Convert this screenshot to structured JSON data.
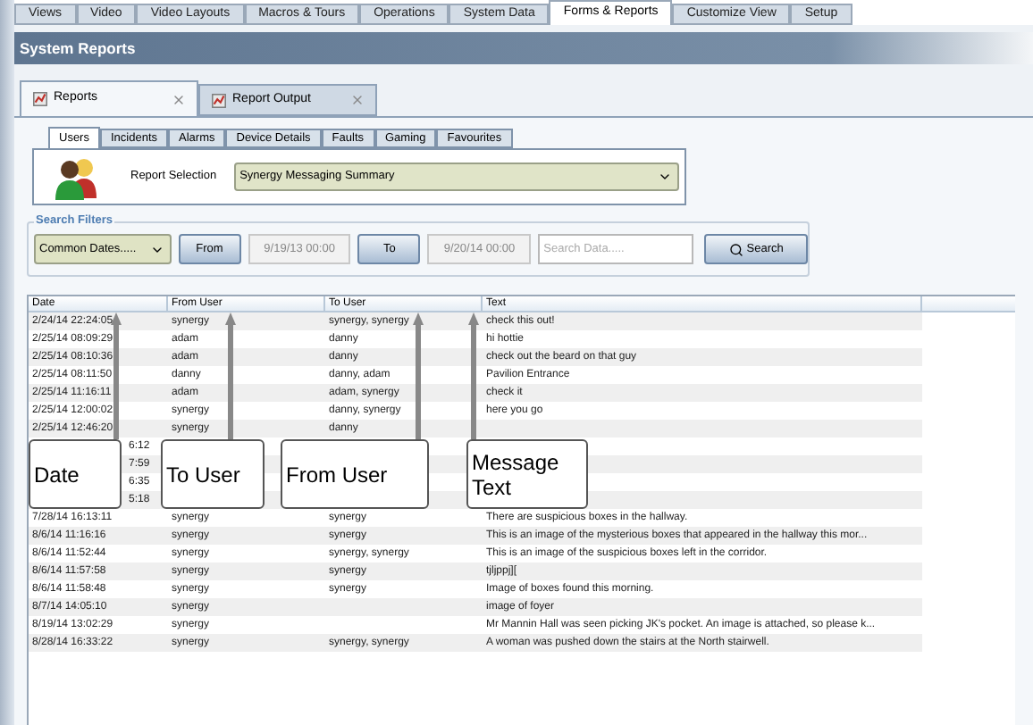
{
  "menu_tabs": [
    {
      "label": "Views",
      "selected": false
    },
    {
      "label": "Video",
      "selected": false
    },
    {
      "label": "Video Layouts",
      "selected": false
    },
    {
      "label": "Macros & Tours",
      "selected": false
    },
    {
      "label": "Operations",
      "selected": false
    },
    {
      "label": "System Data",
      "selected": false
    },
    {
      "label": "Forms & Reports",
      "selected": true
    },
    {
      "label": "Customize View",
      "selected": false
    },
    {
      "label": "Setup",
      "selected": false
    }
  ],
  "panel_title": "System Reports",
  "doc_tabs": [
    {
      "label": "Reports",
      "selected": true
    },
    {
      "label": "Report Output",
      "selected": false
    }
  ],
  "sub_tabs": [
    {
      "label": "Users",
      "selected": true
    },
    {
      "label": "Incidents",
      "selected": false
    },
    {
      "label": "Alarms",
      "selected": false
    },
    {
      "label": "Device Details",
      "selected": false
    },
    {
      "label": "Faults",
      "selected": false
    },
    {
      "label": "Gaming",
      "selected": false
    },
    {
      "label": "Favourites",
      "selected": false
    }
  ],
  "report_selection": {
    "label": "Report Selection",
    "value": "Synergy Messaging Summary"
  },
  "search_filters": {
    "title": "Search Filters",
    "preset": "Common Dates.....",
    "from_button": "From",
    "from_value": "9/19/13 00:00",
    "to_button": "To",
    "to_value": "9/20/14 00:00",
    "search_placeholder": "Search Data.....",
    "search_button": "Search"
  },
  "table": {
    "columns": [
      "Date",
      "From User",
      "To User",
      "Text"
    ],
    "rows": [
      {
        "cells": [
          "2/24/14 22:24:05",
          "synergy",
          "synergy, synergy",
          "check this out!"
        ]
      },
      {
        "cells": [
          "2/25/14 08:09:29",
          "adam",
          "danny",
          "hi hottie"
        ]
      },
      {
        "cells": [
          "2/25/14 08:10:36",
          "adam",
          "danny",
          "check out the beard on that guy"
        ]
      },
      {
        "cells": [
          "2/25/14 08:11:50",
          "danny",
          "danny, adam",
          "Pavilion Entrance"
        ]
      },
      {
        "cells": [
          "2/25/14 11:16:11",
          "adam",
          "adam, synergy",
          "check it"
        ]
      },
      {
        "cells": [
          "2/25/14 12:00:02",
          "synergy",
          "danny, synergy",
          "here you go"
        ]
      },
      {
        "cells": [
          "2/25/14 12:46:20",
          "synergy",
          "danny"
        ]
      },
      {
        "cells": [
          "6:12"
        ]
      },
      {
        "cells": [
          "7:59"
        ]
      },
      {
        "cells": [
          "6:35"
        ]
      },
      {
        "cells": [
          "5:18"
        ]
      },
      {
        "cells": [
          "7/28/14 16:13:11",
          "synergy",
          "synergy",
          "There are suspicious boxes in the hallway."
        ]
      },
      {
        "cells": [
          "8/6/14 11:16:16",
          "synergy",
          "synergy",
          "This is an image of the mysterious boxes that appeared in the hallway this mor..."
        ]
      },
      {
        "cells": [
          "8/6/14 11:52:44",
          "synergy",
          "synergy, synergy",
          "This is an image of the suspicious boxes left in the corridor."
        ]
      },
      {
        "cells": [
          "8/6/14 11:57:58",
          "synergy",
          "synergy",
          "tjljppj]["
        ]
      },
      {
        "cells": [
          "8/6/14 11:58:48",
          "synergy",
          "synergy",
          "Image of boxes found this morning."
        ]
      },
      {
        "cells": [
          "8/7/14 14:05:10",
          "synergy",
          "",
          "image of foyer"
        ]
      },
      {
        "cells": [
          "8/19/14 13:02:29",
          "synergy",
          "",
          "Mr Mannin Hall was seen picking JK's pocket. An image is attached, so please k..."
        ]
      },
      {
        "cells": [
          "8/28/14 16:33:22",
          "synergy",
          "synergy, synergy",
          "A woman was pushed down the stairs at the North stairwell."
        ]
      }
    ]
  },
  "callouts": [
    {
      "text": "Date"
    },
    {
      "text": "To User"
    },
    {
      "text": "From User"
    },
    {
      "text": "Message Text"
    }
  ]
}
